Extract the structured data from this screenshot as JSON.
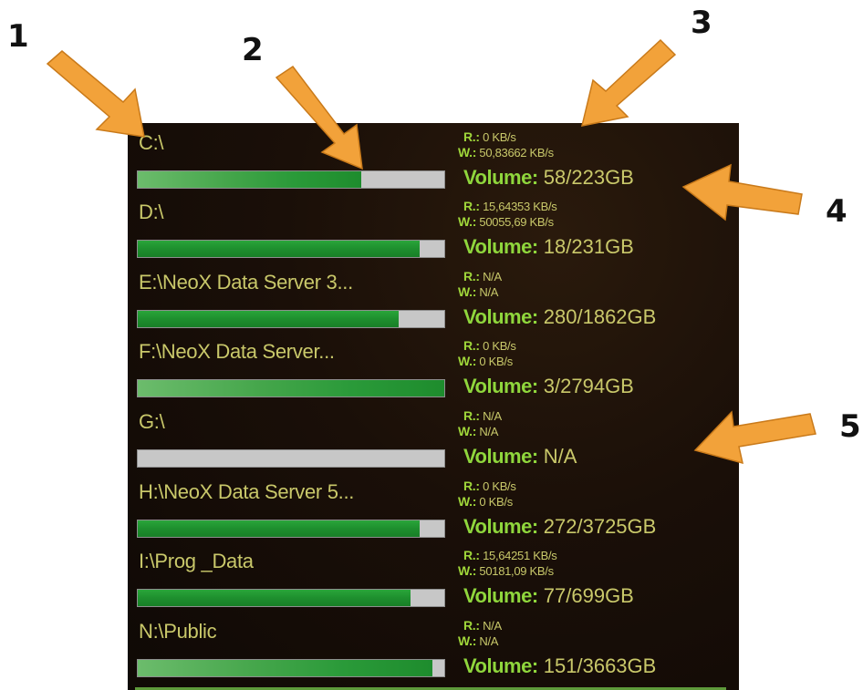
{
  "callouts": [
    "1",
    "2",
    "3",
    "4",
    "5"
  ],
  "drives": [
    {
      "name": "C:\\",
      "fill_fraction": 0.73,
      "soft": true,
      "read": "0 KB/s",
      "write": "50,83662 KB/s",
      "volume": "58/223GB"
    },
    {
      "name": "D:\\",
      "fill_fraction": 0.92,
      "soft": false,
      "read": "15,64353 KB/s",
      "write": "50055,69 KB/s",
      "volume": "18/231GB"
    },
    {
      "name": "E:\\NeoX Data Server 3...",
      "fill_fraction": 0.85,
      "soft": false,
      "read": "N/A",
      "write": "N/A",
      "volume": "280/1862GB"
    },
    {
      "name": "F:\\NeoX Data Server...",
      "fill_fraction": 1.0,
      "soft": true,
      "read": "0 KB/s",
      "write": "0 KB/s",
      "volume": "3/2794GB"
    },
    {
      "name": "G:\\",
      "fill_fraction": 0.0,
      "soft": false,
      "read": "N/A",
      "write": "N/A",
      "volume": "N/A"
    },
    {
      "name": "H:\\NeoX Data Server 5...",
      "fill_fraction": 0.92,
      "soft": false,
      "read": "0 KB/s",
      "write": "0 KB/s",
      "volume": "272/3725GB"
    },
    {
      "name": "I:\\Prog _Data",
      "fill_fraction": 0.89,
      "soft": false,
      "read": "15,64251 KB/s",
      "write": "50181,09 KB/s",
      "volume": "77/699GB"
    },
    {
      "name": "N:\\Public",
      "fill_fraction": 0.96,
      "soft": true,
      "read": "N/A",
      "write": "N/A",
      "volume": "151/3663GB"
    }
  ],
  "labels": {
    "read": "R.:",
    "write": "W.:",
    "volume": "Volume:"
  },
  "colors": {
    "label_text": "#c9c86a",
    "accent_green": "#8fd63c",
    "bar_fill": "#1e8f2e",
    "bar_track": "#c7c7c7",
    "arrow": "#f2a23a",
    "panel_bg": "#1a0f08"
  }
}
